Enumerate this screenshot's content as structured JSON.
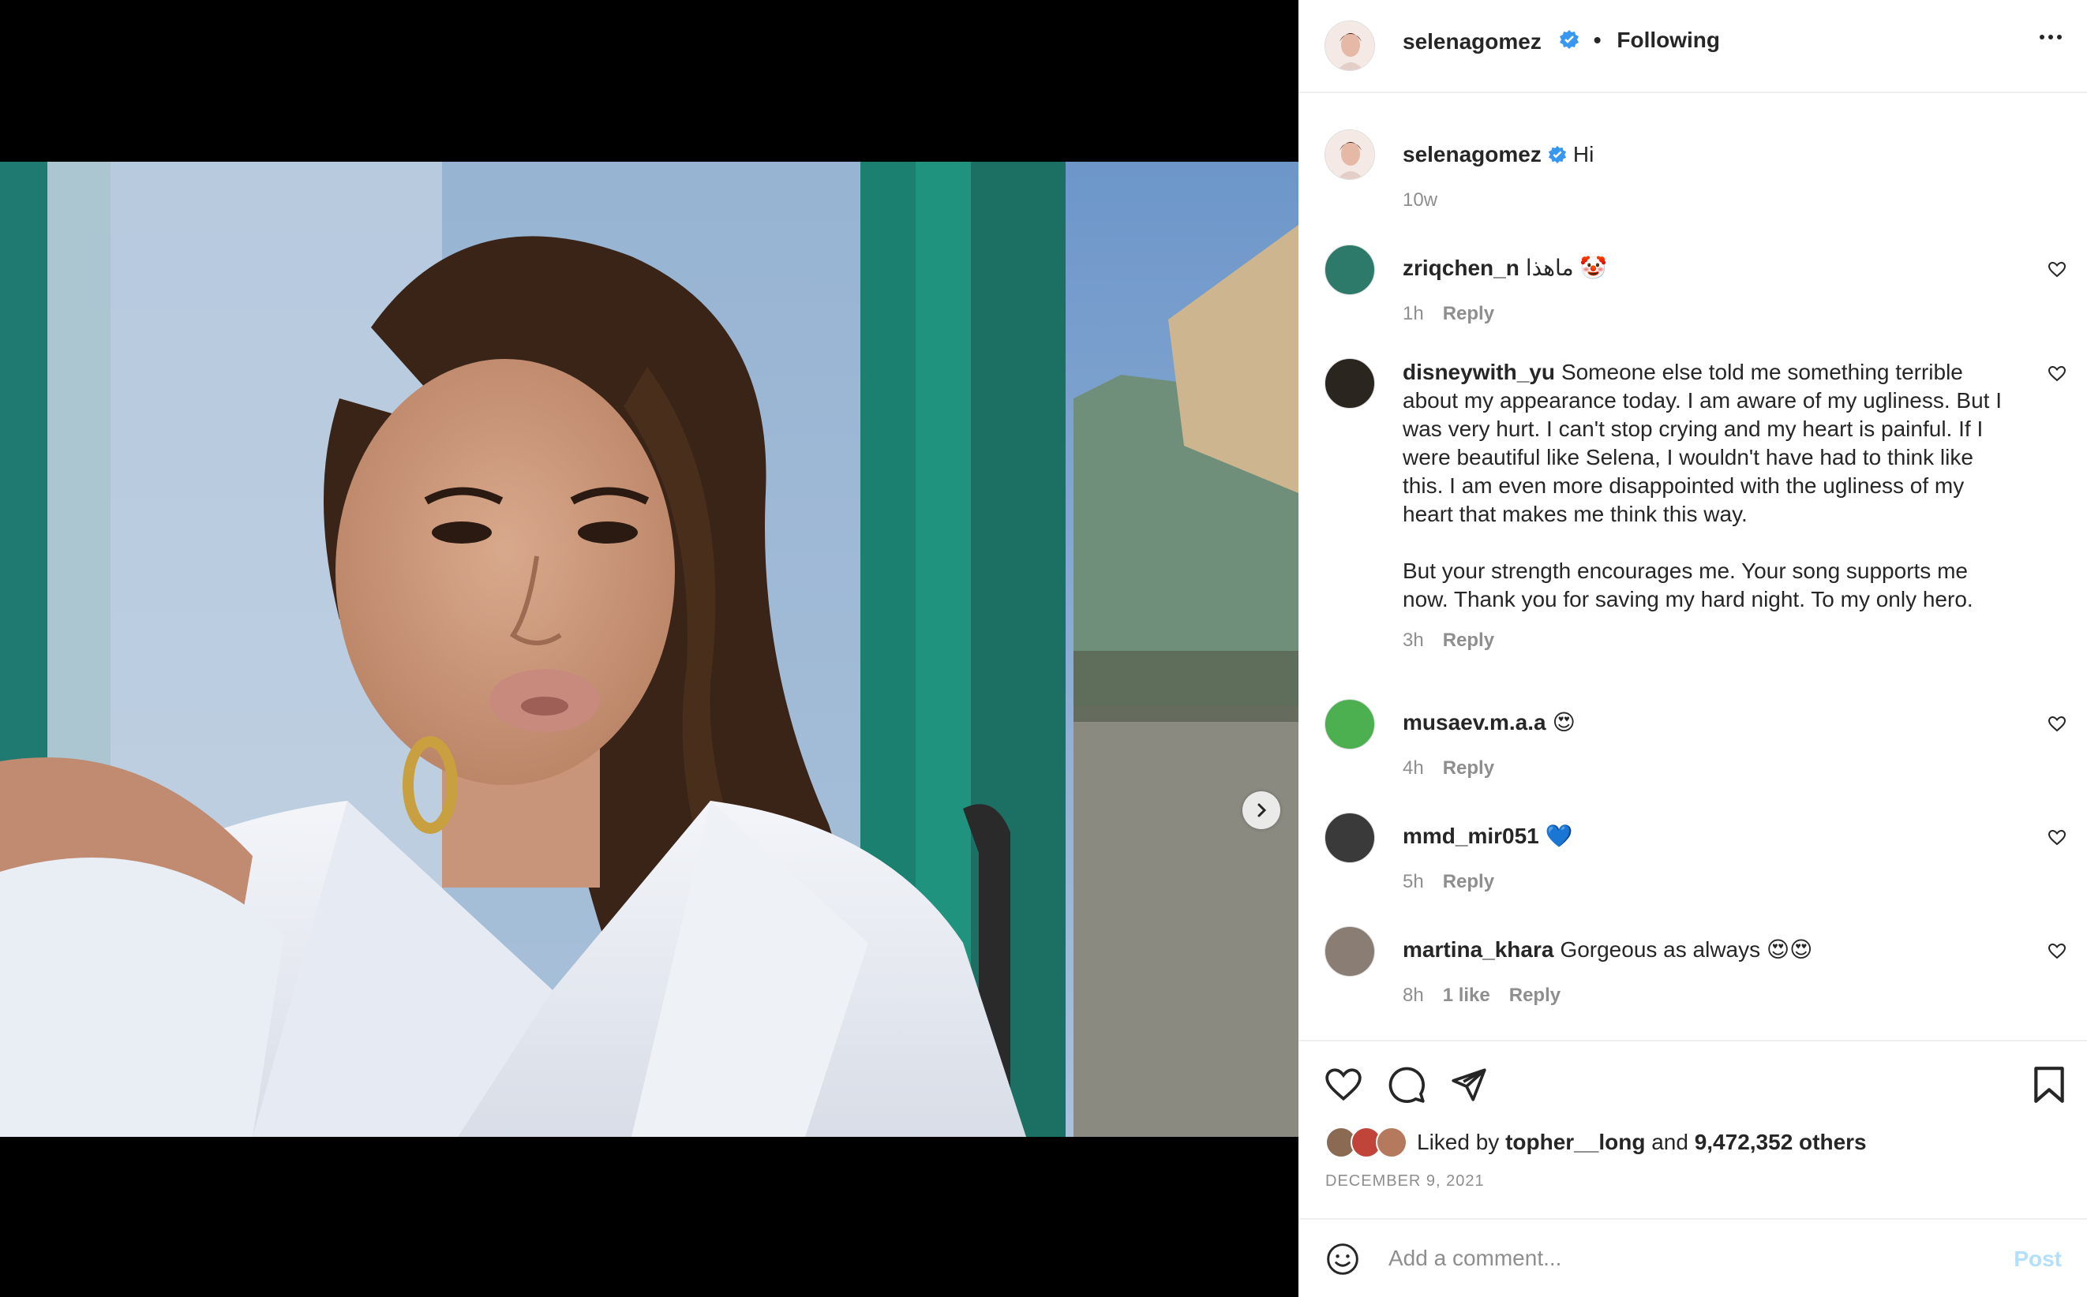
{
  "post": {
    "username": "selenagomez",
    "follow_separator": "•",
    "follow_status": "Following",
    "caption": "Hi",
    "caption_age": "10w",
    "carousel": {
      "slides": 4,
      "active_index": 0
    }
  },
  "comments": [
    {
      "username": "zriqchen_n",
      "text": "ماهذا 🤡",
      "age": "1h",
      "likes_label": "",
      "reply_label": "Reply",
      "avatar_color": "#2d7a6a"
    },
    {
      "username": "disneywith_yu",
      "text": "Someone else told me something terrible about my appearance today. I am aware of my ugliness. But I was very hurt. I can't stop crying and my heart is painful. If I were beautiful like Selena, I wouldn't have had to think like this. I am even more disappointed with the ugliness of my heart that makes me think this way.",
      "text2": "But your strength encourages me. Your song supports me now. Thank you for saving my hard night. To my only hero.",
      "age": "3h",
      "likes_label": "",
      "reply_label": "Reply",
      "avatar_color": "#2b2520"
    },
    {
      "username": "musaev.m.a.a",
      "text": "😍",
      "age": "4h",
      "likes_label": "",
      "reply_label": "Reply",
      "avatar_color": "#4caf50"
    },
    {
      "username": "mmd_mir051",
      "text": "💙",
      "age": "5h",
      "likes_label": "",
      "reply_label": "Reply",
      "avatar_color": "#3a3a3a"
    },
    {
      "username": "martina_khara",
      "text": "Gorgeous as always 😍😍",
      "age": "8h",
      "likes_label": "1 like",
      "reply_label": "Reply",
      "avatar_color": "#8a7d74"
    }
  ],
  "likes": {
    "prefix": "Liked by",
    "user": "topher__long",
    "conjunction": "and",
    "count": "9,472,352 others"
  },
  "date": "DECEMBER 9, 2021",
  "comment_box": {
    "placeholder": "Add a comment...",
    "post_label": "Post"
  },
  "icons": {
    "like": "heart-icon",
    "comment": "comment-bubble-icon",
    "share": "paper-plane-icon",
    "save": "bookmark-icon",
    "emoji": "smiley-icon",
    "verified": "verified-badge-icon",
    "next": "chevron-right-icon"
  },
  "colors": {
    "verified": "#3897f0",
    "muted": "#8e8e8e",
    "post_disabled": "#b2dffc"
  }
}
